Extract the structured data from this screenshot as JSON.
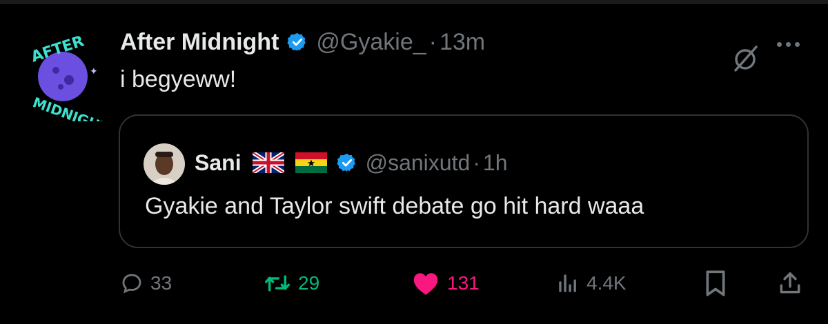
{
  "tweet": {
    "display_name": "After Midnight",
    "handle": "@Gyakie_",
    "separator": "·",
    "time": "13m",
    "text": "i begyeww!",
    "avatar_text": "AFTER MIDNIGHT"
  },
  "quote": {
    "display_name": "Sani",
    "flags": [
      "uk-flag-icon",
      "ghana-flag-icon"
    ],
    "handle": "@sanixutd",
    "separator": "·",
    "time": "1h",
    "text": "Gyakie and Taylor swift debate go hit hard waaa"
  },
  "actions": {
    "replies": "33",
    "retweets": "29",
    "likes": "131",
    "views": "4.4K"
  },
  "colors": {
    "verified": "#1d9bf0",
    "retweet": "#00ba7c",
    "like": "#f91880",
    "muted": "#71767b",
    "avatar_accent": "#3ee0d0",
    "avatar_moon": "#6a4fe0"
  }
}
